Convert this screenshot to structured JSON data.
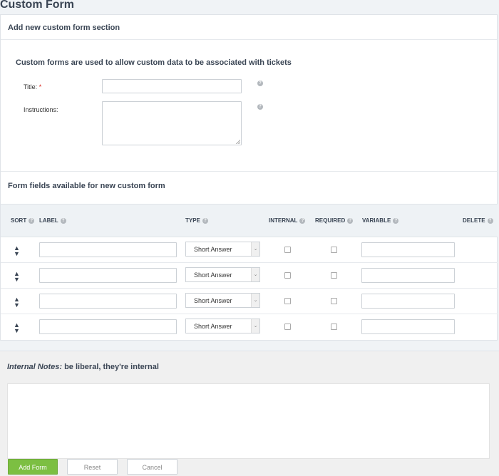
{
  "page": {
    "title": "Custom Form"
  },
  "section": {
    "header": "Add new custom form section",
    "description": "Custom forms are used to allow custom data to be associated with tickets",
    "title_label": "Title:",
    "title_required": "*",
    "title_value": "",
    "instructions_label": "Instructions:",
    "instructions_value": ""
  },
  "fields": {
    "header": "Form fields available for new custom form",
    "columns": {
      "sort": "SORT",
      "label": "LABEL",
      "type": "TYPE",
      "internal": "INTERNAL",
      "required": "REQUIRED",
      "variable": "VARIABLE",
      "delete": "DELETE"
    },
    "rows": [
      {
        "label": "",
        "type": "Short Answer",
        "internal": false,
        "required": false,
        "variable": ""
      },
      {
        "label": "",
        "type": "Short Answer",
        "internal": false,
        "required": false,
        "variable": ""
      },
      {
        "label": "",
        "type": "Short Answer",
        "internal": false,
        "required": false,
        "variable": ""
      },
      {
        "label": "",
        "type": "Short Answer",
        "internal": false,
        "required": false,
        "variable": ""
      }
    ]
  },
  "notes": {
    "title_em": "Internal Notes:",
    "title_rest": " be liberal, they're internal",
    "value": ""
  },
  "actions": {
    "add": "Add Form",
    "reset": "Reset",
    "cancel": "Cancel"
  },
  "icons": {
    "help": "help-circle-icon",
    "sort": "sort-arrows-icon",
    "dropdown": "chevron-down-icon"
  },
  "colors": {
    "primary_button": "#7cbf42",
    "heading": "#3a4554",
    "required_star": "#d9261c"
  }
}
